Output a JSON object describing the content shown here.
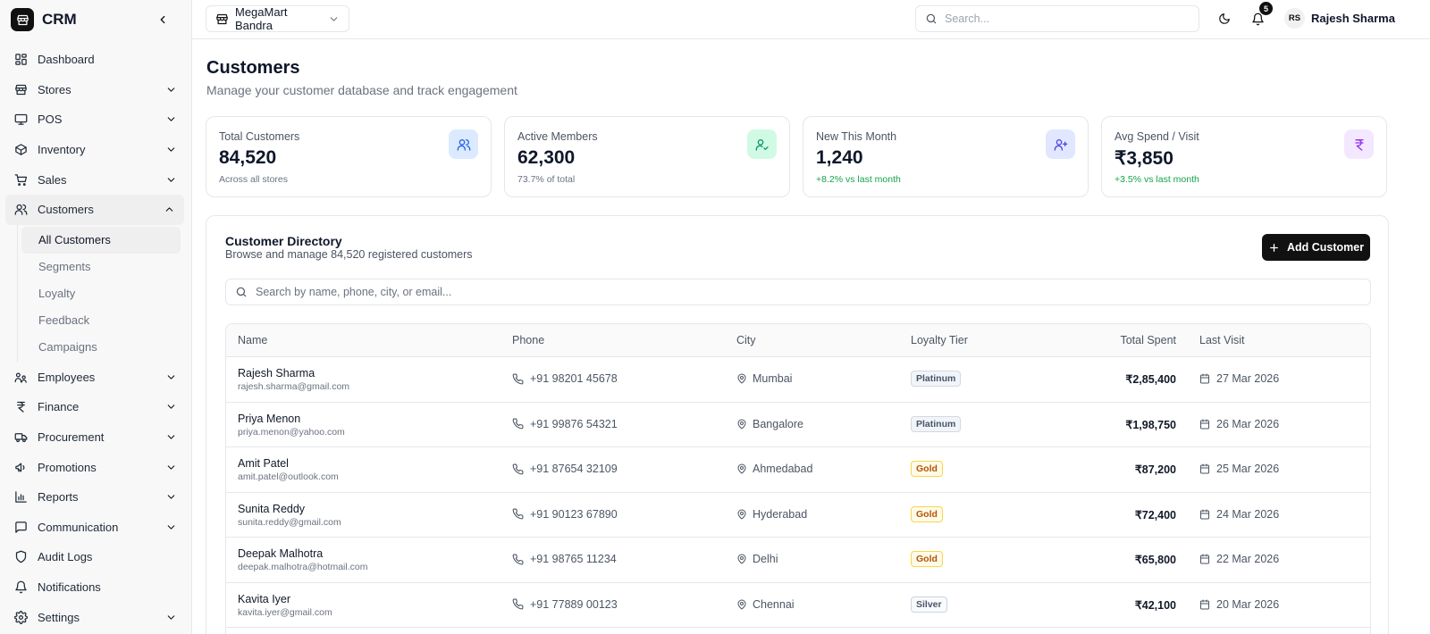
{
  "app": {
    "name": "CRM"
  },
  "sidebar": {
    "items": [
      {
        "label": "Dashboard",
        "icon": "dashboard-icon",
        "chevron": false
      },
      {
        "label": "Stores",
        "icon": "store-icon",
        "chevron": true
      },
      {
        "label": "POS",
        "icon": "monitor-icon",
        "chevron": true
      },
      {
        "label": "Inventory",
        "icon": "package-icon",
        "chevron": true
      },
      {
        "label": "Sales",
        "icon": "cart-icon",
        "chevron": true
      },
      {
        "label": "Customers",
        "icon": "users-icon",
        "chevron": true,
        "expanded": true
      },
      {
        "label": "Employees",
        "icon": "employees-icon",
        "chevron": true
      },
      {
        "label": "Finance",
        "icon": "rupee-icon",
        "chevron": true
      },
      {
        "label": "Procurement",
        "icon": "truck-icon",
        "chevron": true
      },
      {
        "label": "Promotions",
        "icon": "megaphone-icon",
        "chevron": true
      },
      {
        "label": "Reports",
        "icon": "bar-chart-icon",
        "chevron": true
      },
      {
        "label": "Communication",
        "icon": "message-icon",
        "chevron": true
      },
      {
        "label": "Audit Logs",
        "icon": "shield-icon",
        "chevron": false
      },
      {
        "label": "Notifications",
        "icon": "bell-icon",
        "chevron": false
      },
      {
        "label": "Settings",
        "icon": "settings-icon",
        "chevron": true
      }
    ],
    "customers_sub": [
      "All Customers",
      "Segments",
      "Loyalty",
      "Feedback",
      "Campaigns"
    ]
  },
  "topbar": {
    "store": "MegaMart Bandra",
    "search_placeholder": "Search...",
    "notification_count": "5",
    "user_initials": "RS",
    "user_name": "Rajesh Sharma"
  },
  "page": {
    "title": "Customers",
    "subtitle": "Manage your customer database and track engagement"
  },
  "stats": [
    {
      "label": "Total Customers",
      "value": "84,520",
      "note": "Across all stores",
      "positive": false,
      "icon": "users-icon",
      "icon_bg": "#dbeafe",
      "icon_color": "#2563eb"
    },
    {
      "label": "Active Members",
      "value": "62,300",
      "note": "73.7% of total",
      "positive": false,
      "icon": "user-check-icon",
      "icon_bg": "#d1fae5",
      "icon_color": "#059669"
    },
    {
      "label": "New This Month",
      "value": "1,240",
      "note": "+8.2% vs last month",
      "positive": true,
      "icon": "user-plus-icon",
      "icon_bg": "#e0e7ff",
      "icon_color": "#4f46e5"
    },
    {
      "label": "Avg Spend / Visit",
      "value": "₹3,850",
      "note": "+3.5% vs last month",
      "positive": true,
      "icon": "rupee-icon",
      "icon_bg": "#f3e8ff",
      "icon_color": "#9333ea"
    }
  ],
  "directory": {
    "title": "Customer Directory",
    "subtitle": "Browse and manage 84,520 registered customers",
    "add_label": "Add Customer",
    "search_placeholder": "Search by name, phone, city, or email...",
    "columns": [
      "Name",
      "Phone",
      "City",
      "Loyalty Tier",
      "Total Spent",
      "Last Visit"
    ],
    "rows": [
      {
        "name": "Rajesh Sharma",
        "email": "rajesh.sharma@gmail.com",
        "phone": "+91 98201 45678",
        "city": "Mumbai",
        "tier": "Platinum",
        "spent": "₹2,85,400",
        "visit": "27 Mar 2026"
      },
      {
        "name": "Priya Menon",
        "email": "priya.menon@yahoo.com",
        "phone": "+91 99876 54321",
        "city": "Bangalore",
        "tier": "Platinum",
        "spent": "₹1,98,750",
        "visit": "26 Mar 2026"
      },
      {
        "name": "Amit Patel",
        "email": "amit.patel@outlook.com",
        "phone": "+91 87654 32109",
        "city": "Ahmedabad",
        "tier": "Gold",
        "spent": "₹87,200",
        "visit": "25 Mar 2026"
      },
      {
        "name": "Sunita Reddy",
        "email": "sunita.reddy@gmail.com",
        "phone": "+91 90123 67890",
        "city": "Hyderabad",
        "tier": "Gold",
        "spent": "₹72,400",
        "visit": "24 Mar 2026"
      },
      {
        "name": "Deepak Malhotra",
        "email": "deepak.malhotra@hotmail.com",
        "phone": "+91 98765 11234",
        "city": "Delhi",
        "tier": "Gold",
        "spent": "₹65,800",
        "visit": "22 Mar 2026"
      },
      {
        "name": "Kavita Iyer",
        "email": "kavita.iyer@gmail.com",
        "phone": "+91 77889 00123",
        "city": "Chennai",
        "tier": "Silver",
        "spent": "₹42,100",
        "visit": "20 Mar 2026"
      }
    ]
  }
}
